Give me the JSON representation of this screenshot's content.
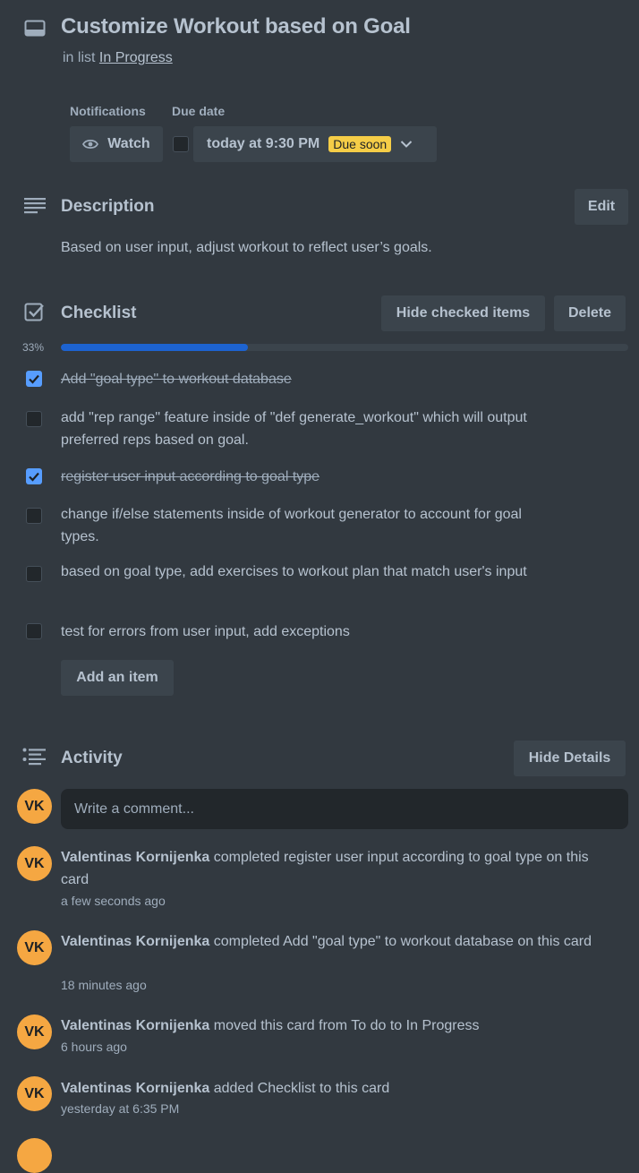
{
  "card": {
    "title": "Customize Workout based on Goal",
    "in_list_prefix": "in list",
    "list_name": "In Progress"
  },
  "notifications": {
    "label": "Notifications",
    "watch_label": "Watch"
  },
  "due": {
    "label": "Due date",
    "value": "today at 9:30 PM",
    "badge": "Due soon"
  },
  "description": {
    "heading": "Description",
    "edit_label": "Edit",
    "text": "Based on user input, adjust workout to reflect user’s goals."
  },
  "checklist": {
    "heading": "Checklist",
    "hide_checked_label": "Hide checked items",
    "delete_label": "Delete",
    "percent_label": "33%",
    "progress": 0.33,
    "add_item_label": "Add an item",
    "items": [
      {
        "text": "Add \"goal type\" to workout database",
        "checked": true
      },
      {
        "text": "add \"rep range\" feature inside of \"def generate_workout\" which will output preferred reps based on goal.",
        "checked": false
      },
      {
        "text": "register user input according to goal type",
        "checked": true
      },
      {
        "text": "change if/else statements inside of workout generator to account for goal types.",
        "checked": false
      },
      {
        "text": "based on goal type, add exercises to workout plan that match user's input",
        "checked": false
      },
      {
        "text": "test for errors from user input, add exceptions",
        "checked": false
      }
    ]
  },
  "activity": {
    "heading": "Activity",
    "hide_details_label": "Hide Details",
    "comment_placeholder": "Write a comment...",
    "user_initials": "VK",
    "entries": [
      {
        "user": "Valentinas Kornijenka",
        "action": "completed register user input according to goal type on this card",
        "time": "a few seconds ago"
      },
      {
        "user": "Valentinas Kornijenka",
        "action": "completed Add \"goal type\" to workout database on this card",
        "time": "18 minutes ago"
      },
      {
        "user": "Valentinas Kornijenka",
        "action": "moved this card from To do to In Progress",
        "time": "6 hours ago"
      },
      {
        "user": "Valentinas Kornijenka",
        "action": "added Checklist to this card",
        "time": "yesterday at 6:35 PM"
      }
    ]
  }
}
